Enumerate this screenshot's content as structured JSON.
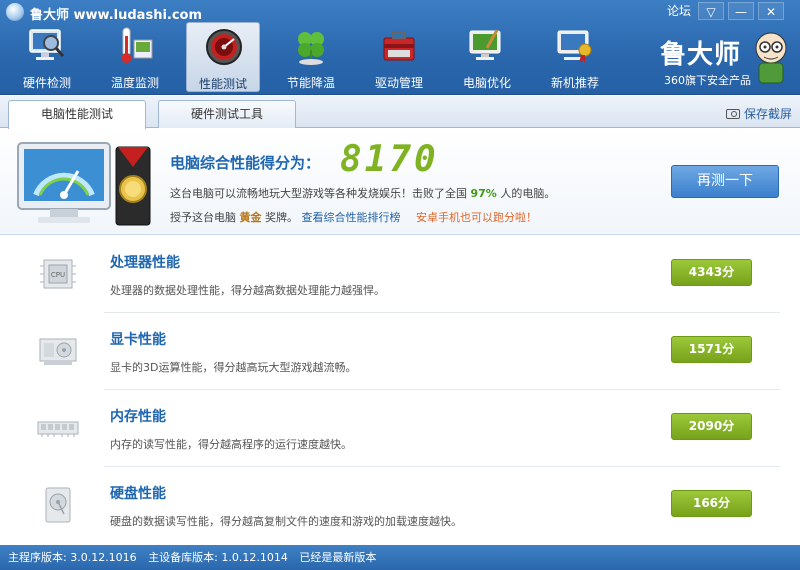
{
  "app": {
    "title": "鲁大师 www.ludashi.com",
    "forum": "论坛",
    "brand_name": "鲁大师",
    "brand_sub": "360旗下安全产品"
  },
  "window_controls": [
    "▽",
    "—",
    "✕"
  ],
  "nav": [
    {
      "label": "硬件检测",
      "icon": "monitor-magnifier-icon"
    },
    {
      "label": "温度监测",
      "icon": "thermometer-icon"
    },
    {
      "label": "性能测试",
      "icon": "speedometer-icon",
      "active": true
    },
    {
      "label": "节能降温",
      "icon": "clover-icon"
    },
    {
      "label": "驱动管理",
      "icon": "toolbox-icon"
    },
    {
      "label": "电脑优化",
      "icon": "broom-monitor-icon"
    },
    {
      "label": "新机推荐",
      "icon": "award-monitor-icon"
    }
  ],
  "tabs": [
    {
      "label": "电脑性能测试",
      "active": true
    },
    {
      "label": "硬件测试工具",
      "active": false
    }
  ],
  "screenshot_label": "保存截屏",
  "summary": {
    "score_title": "电脑综合性能得分为：",
    "score": "8170",
    "line1_a": "这台电脑可以流畅地玩大型游戏等各种发烧娱乐！击败了全国 ",
    "line1_pct": "97%",
    "line1_b": " 人的电脑。",
    "line2_a": "授予这台电脑 ",
    "line2_medal": "黄金",
    "line2_b": " 奖牌。",
    "ranking_link": "查看综合性能排行榜",
    "mobile_link": "安卓手机也可以跑分啦！",
    "retest_label": "再测一下"
  },
  "rows": [
    {
      "title": "处理器性能",
      "desc": "处理器的数据处理性能，得分越高数据处理能力越强悍。",
      "score": "4343分",
      "icon": "cpu-chip-icon"
    },
    {
      "title": "显卡性能",
      "desc": "显卡的3D运算性能，得分越高玩大型游戏越流畅。",
      "score": "1571分",
      "icon": "graphics-card-icon"
    },
    {
      "title": "内存性能",
      "desc": "内存的读写性能，得分越高程序的运行速度越快。",
      "score": "2090分",
      "icon": "memory-stick-icon"
    },
    {
      "title": "硬盘性能",
      "desc": "硬盘的数据读写性能，得分越高复制文件的速度和游戏的加载速度越快。",
      "score": "166分",
      "icon": "hard-disk-icon"
    }
  ],
  "status": {
    "version": "主程序版本: 3.0.12.1016",
    "db_version": "主设备库版本: 1.0.12.1014",
    "latest": "已经是最新版本"
  },
  "colors": {
    "header_blue": "#2a67ad",
    "title_blue": "#2067b0",
    "score_green": "#7fb321",
    "button_blue": "#3b7fcc"
  }
}
